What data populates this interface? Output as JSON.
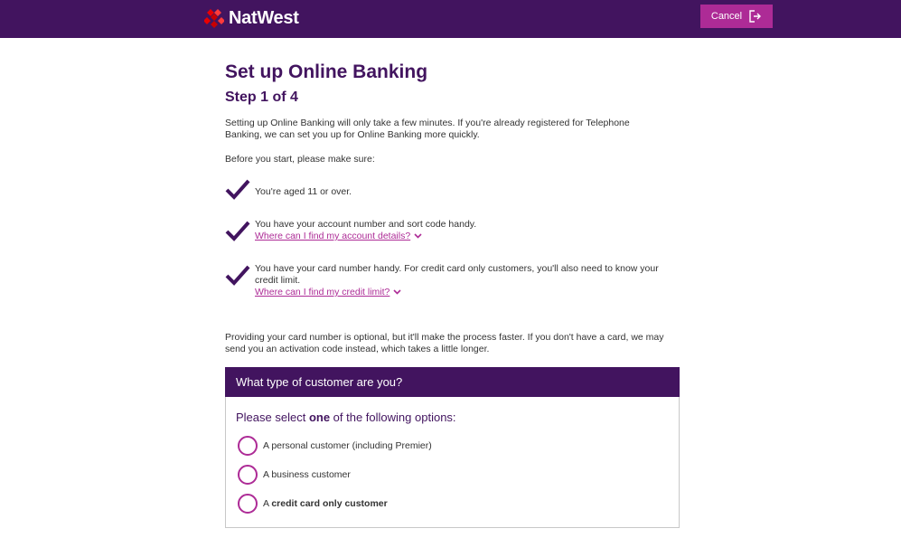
{
  "header": {
    "brand": "NatWest",
    "cancel_label": "Cancel",
    "colors": {
      "brand_purple": "#42145f",
      "accent_magenta": "#ad2b96",
      "logo_red": "#e90000"
    },
    "icons": {
      "logo": "natwest-cubes-logo",
      "cancel": "exit-icon"
    }
  },
  "main": {
    "title": "Set up Online Banking",
    "step": "Step 1 of 4",
    "intro": "Setting up Online Banking will only take a few minutes. If you're already registered for Telephone Banking, we can set you up for Online Banking more quickly.",
    "before_start": "Before you start, please make sure:",
    "checklist": [
      {
        "text": "You're aged 11 or over."
      },
      {
        "text": "You have your account number and sort code handy.",
        "link": "Where can I find my account details?"
      },
      {
        "text": "You have your card number handy. For credit card only customers, you'll also need to know your",
        "text2": "credit limit.",
        "link": "Where can I find my credit limit?"
      }
    ],
    "note": "Providing your card number is optional, but it'll make the process faster. If you don't have a card, we may send you an activation code instead, which takes a little longer."
  },
  "customer_type": {
    "heading": "What type of customer are you?",
    "question_pre": "Please select ",
    "question_bold": "one",
    "question_post": " of the following options:",
    "options": [
      {
        "label": "A personal customer (including Premier)"
      },
      {
        "label": "A business customer"
      },
      {
        "label_pre": "A ",
        "label_bold": "credit card only customer"
      }
    ]
  }
}
